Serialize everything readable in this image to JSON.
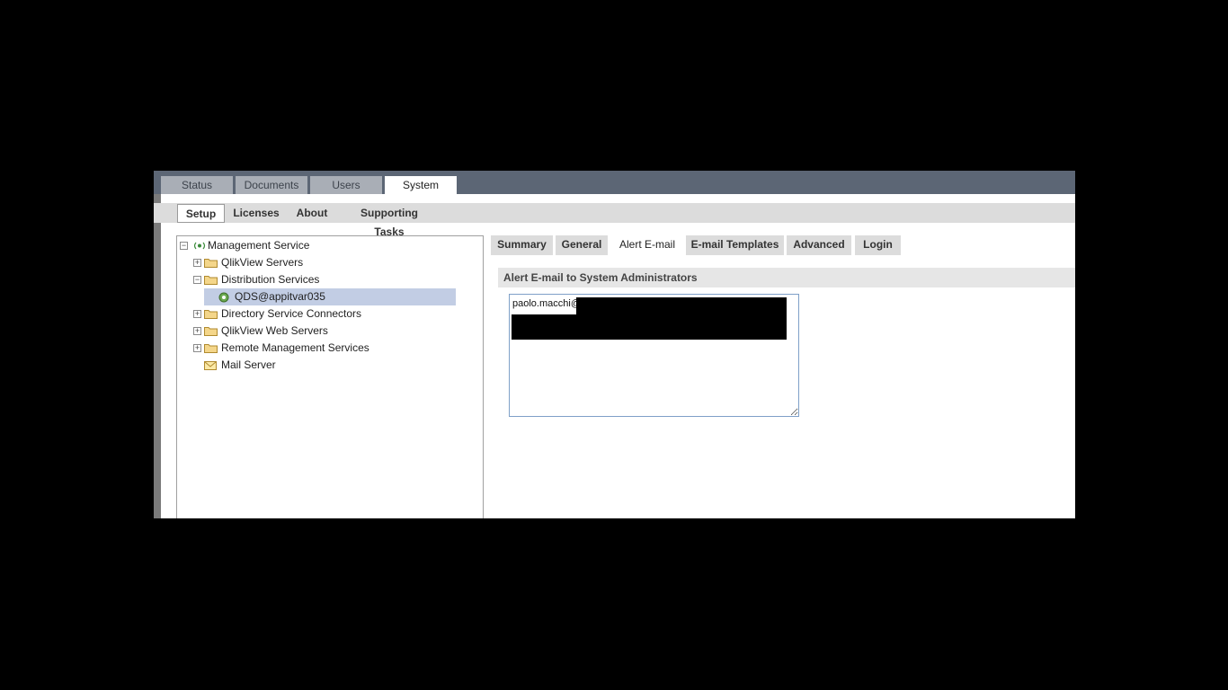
{
  "top_tabs": [
    {
      "label": "Status"
    },
    {
      "label": "Documents"
    },
    {
      "label": "Users"
    },
    {
      "label": "System"
    }
  ],
  "sub_tabs": [
    {
      "label": "Setup"
    },
    {
      "label": "Licenses"
    },
    {
      "label": "About"
    },
    {
      "label": "Supporting Tasks"
    }
  ],
  "tree": {
    "root": "Management Service",
    "items": [
      {
        "label": "QlikView Servers"
      },
      {
        "label": "Distribution Services"
      },
      {
        "label": "QDS@appitvar035"
      },
      {
        "label": "Directory Service Connectors"
      },
      {
        "label": "QlikView Web Servers"
      },
      {
        "label": "Remote Management Services"
      },
      {
        "label": "Mail Server"
      }
    ]
  },
  "right_tabs": [
    {
      "label": "Summary"
    },
    {
      "label": "General"
    },
    {
      "label": "Alert E-mail"
    },
    {
      "label": "E-mail Templates"
    },
    {
      "label": "Advanced"
    },
    {
      "label": "Login"
    }
  ],
  "section": {
    "title": "Alert E-mail to System Administrators",
    "email_value": "paolo.macchi@"
  },
  "colors": {
    "topbar": "#5c6675",
    "selected_node": "#c2cde4",
    "input_border": "#7fa0c8"
  }
}
